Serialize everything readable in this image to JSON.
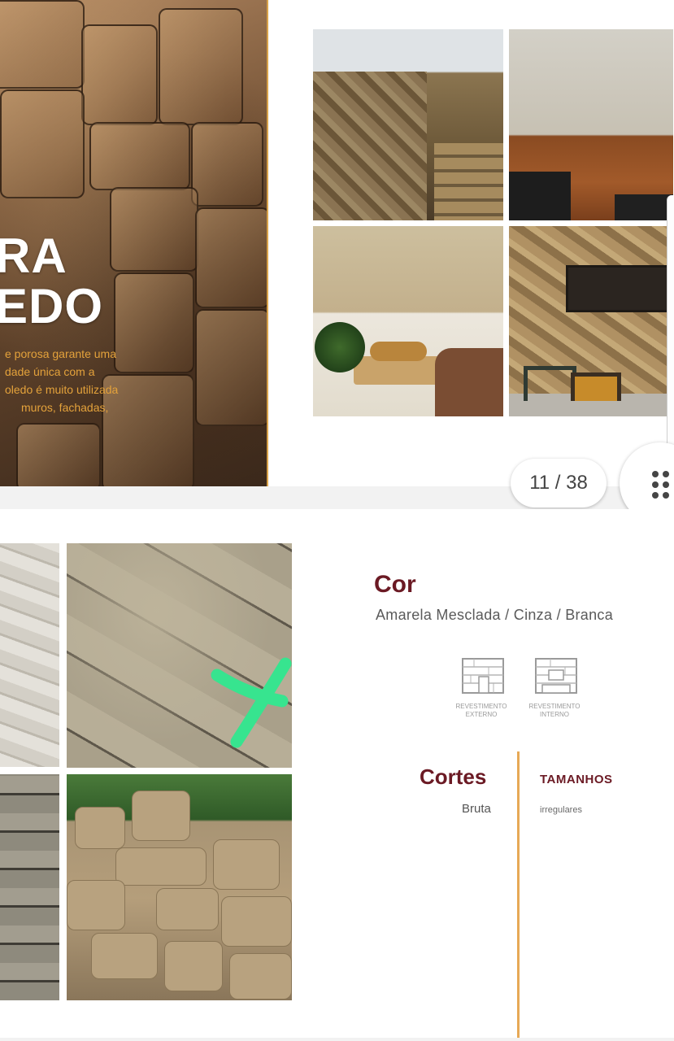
{
  "viewer": {
    "page_counter": "11 / 38",
    "grid_button_icon": "grid-dots-icon"
  },
  "page1": {
    "title_lines": [
      "RA",
      "EDO"
    ],
    "body_lines": [
      "e porosa garante uma",
      "dade única com a",
      "oledo é muito utilizada",
      "muros, fachadas,"
    ],
    "accent_color": "#e4a23b"
  },
  "page2": {
    "cor": {
      "heading": "Cor",
      "values": "Amarela Mesclada / Cinza / Branca"
    },
    "applications": [
      {
        "icon": "external-cladding-icon",
        "label_lines": [
          "REVESTIMENTO",
          "EXTERNO"
        ]
      },
      {
        "icon": "internal-cladding-icon",
        "label_lines": [
          "REVESTIMENTO",
          "INTERNO"
        ]
      }
    ],
    "cortes": {
      "heading": "Cortes",
      "value": "Bruta"
    },
    "tamanhos": {
      "heading": "TAMANHOS",
      "value": "irregulares"
    },
    "heading_color": "#6b1a24",
    "divider_color": "#e7a956",
    "mark_color": "#37e48f"
  }
}
